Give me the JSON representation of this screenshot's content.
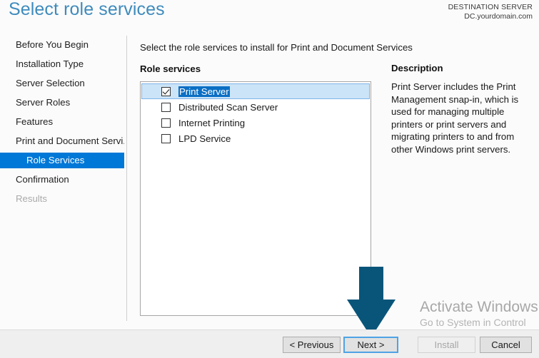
{
  "header": {
    "title": "Select role services",
    "destination_label": "DESTINATION SERVER",
    "destination_value": "DC.yourdomain.com"
  },
  "sidebar": {
    "items": [
      {
        "label": "Before You Begin",
        "state": "normal",
        "indent": false
      },
      {
        "label": "Installation Type",
        "state": "normal",
        "indent": false
      },
      {
        "label": "Server Selection",
        "state": "normal",
        "indent": false
      },
      {
        "label": "Server Roles",
        "state": "normal",
        "indent": false
      },
      {
        "label": "Features",
        "state": "normal",
        "indent": false
      },
      {
        "label": "Print and Document Servi...",
        "state": "normal",
        "indent": false
      },
      {
        "label": "Role Services",
        "state": "selected",
        "indent": true
      },
      {
        "label": "Confirmation",
        "state": "normal",
        "indent": false
      },
      {
        "label": "Results",
        "state": "disabled",
        "indent": false
      }
    ]
  },
  "main": {
    "instruction": "Select the role services to install for Print and Document Services",
    "role_services_label": "Role services",
    "role_services": [
      {
        "label": "Print Server",
        "checked": true,
        "selected": true
      },
      {
        "label": "Distributed Scan Server",
        "checked": false,
        "selected": false
      },
      {
        "label": "Internet Printing",
        "checked": false,
        "selected": false
      },
      {
        "label": "LPD Service",
        "checked": false,
        "selected": false
      }
    ]
  },
  "description": {
    "title": "Description",
    "body": "Print Server includes the Print Management snap-in, which is used for managing multiple printers or print servers and migrating printers to and from other Windows print servers."
  },
  "watermark": {
    "title": "Activate Windows",
    "subtitle": "Go to System in Control Panel to activate Windows."
  },
  "footer": {
    "previous_label": "< Previous",
    "next_label": "Next >",
    "install_label": "Install",
    "cancel_label": "Cancel"
  },
  "annotation": {
    "arrow_color": "#09557a",
    "points_to": "Next >"
  },
  "colors": {
    "title_blue": "#3f8bbd",
    "selection_blue": "#0078d7",
    "row_highlight": "#cce4f7",
    "arrow": "#09557a"
  }
}
